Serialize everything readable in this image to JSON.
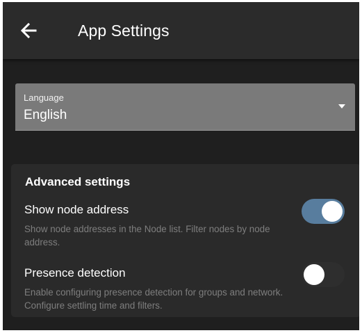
{
  "appbar": {
    "title": "App Settings",
    "back_icon": "arrow-left-icon"
  },
  "language": {
    "label": "Language",
    "value": "English",
    "icon": "dropdown-arrow-icon"
  },
  "advanced": {
    "title": "Advanced settings",
    "settings": [
      {
        "title": "Show node address",
        "description": "Show node addresses in the Node list. Filter nodes by node address.",
        "enabled": true
      },
      {
        "title": "Presence detection",
        "description": "Enable configuring presence detection for groups and network. Configure settling time and filters.",
        "enabled": false
      }
    ]
  },
  "colors": {
    "background": "#1f1f1f",
    "appbar": "#2b2b2b",
    "select_fill": "#7a7a7a",
    "card": "#2a2a2a",
    "switch_on_track": "#587d9e",
    "switch_off_track": "#2e2e2e",
    "secondary_text": "#7e7e7e"
  }
}
